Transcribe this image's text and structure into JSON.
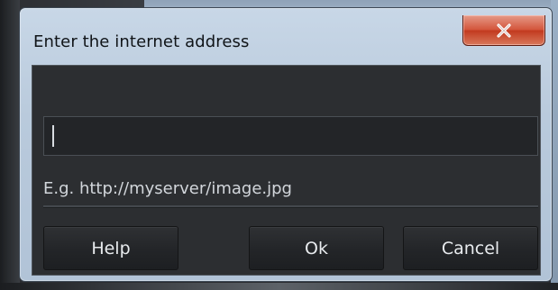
{
  "dialog": {
    "title": "Enter the internet address",
    "close_icon": "close-icon",
    "address_value": "",
    "example": "E.g. http://myserver/image.jpg"
  },
  "buttons": {
    "help": "Help",
    "ok": "Ok",
    "cancel": "Cancel"
  },
  "colors": {
    "client_background": "#2c2e31",
    "input_background": "#232528",
    "close_button": "#c8432a",
    "title_bar": "#bccddf"
  }
}
